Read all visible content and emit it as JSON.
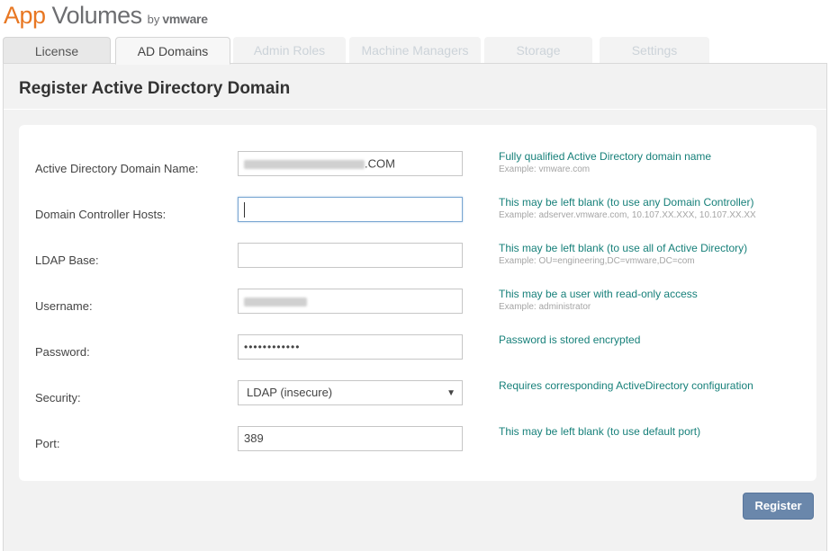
{
  "logo": {
    "app": "App",
    "volumes": " Volumes",
    "by": "by",
    "vmware": "vmware"
  },
  "tabs": [
    {
      "label": "License",
      "state": "enabled"
    },
    {
      "label": "AD Domains",
      "state": "active"
    },
    {
      "label": "Admin Roles",
      "state": "disabled"
    },
    {
      "label": "Machine Managers",
      "state": "disabled"
    },
    {
      "label": "Storage",
      "state": "disabled"
    },
    {
      "label": "Settings",
      "state": "disabled"
    }
  ],
  "page": {
    "title": "Register Active Directory Domain"
  },
  "form": {
    "domain_name": {
      "label": "Active Directory Domain Name:",
      "value_suffix": ".COM",
      "help": "Fully qualified Active Directory domain name",
      "example": "Example: vmware.com"
    },
    "dc_hosts": {
      "label": "Domain Controller Hosts:",
      "value": "",
      "help": "This may be left blank (to use any Domain Controller)",
      "example": "Example: adserver.vmware.com, 10.107.XX.XXX, 10.107.XX.XX"
    },
    "ldap_base": {
      "label": "LDAP Base:",
      "value": "",
      "help": "This may be left blank (to use all of Active Directory)",
      "example": "Example: OU=engineering,DC=vmware,DC=com"
    },
    "username": {
      "label": "Username:",
      "help": "This may be a user with read-only access",
      "example": "Example: administrator"
    },
    "password": {
      "label": "Password:",
      "value": "••••••••••••",
      "help": "Password is stored encrypted"
    },
    "security": {
      "label": "Security:",
      "selected": "LDAP (insecure)",
      "help": "Requires corresponding ActiveDirectory configuration"
    },
    "port": {
      "label": "Port:",
      "value": "389",
      "help": "This may be left blank (to use default port)"
    }
  },
  "actions": {
    "register_label": "Register"
  },
  "colors": {
    "accent_orange": "#e87722",
    "help_teal": "#17807a",
    "button_blue": "#6a87ab"
  }
}
